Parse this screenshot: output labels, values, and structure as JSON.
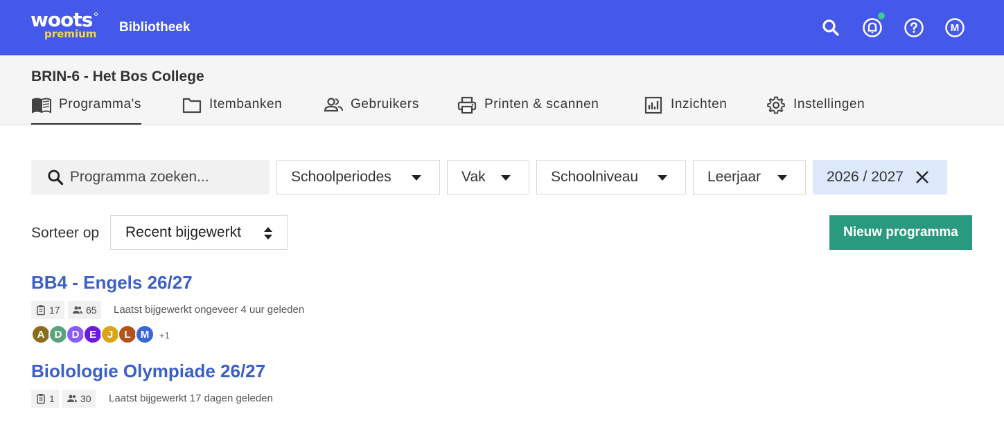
{
  "header": {
    "logo_main": "woots",
    "logo_sub": "premium",
    "app_title": "Bibliotheek",
    "avatar_initial": "M",
    "colors": {
      "bar": "#4458ea",
      "logo_sub": "#f6d54c",
      "notification_dot": "#3ec99a"
    },
    "icons": [
      "search-icon",
      "notification-bell-icon",
      "help-icon",
      "user-avatar-icon"
    ]
  },
  "school": {
    "name": "BRIN-6 - Het Bos College"
  },
  "tabs": [
    {
      "label": "Programma's",
      "icon": "open-book-icon"
    },
    {
      "label": "Itembanken",
      "icon": "folder-icon"
    },
    {
      "label": "Gebruikers",
      "icon": "users-icon"
    },
    {
      "label": "Printen & scannen",
      "icon": "printer-icon"
    },
    {
      "label": "Inzichten",
      "icon": "bar-chart-icon"
    },
    {
      "label": "Instellingen",
      "icon": "gear-icon"
    }
  ],
  "filters": {
    "search_placeholder": "Programma zoeken...",
    "dropdowns": [
      "Schoolperiodes",
      "Vak",
      "Schoolniveau",
      "Leerjaar"
    ],
    "active_year": "2026 / 2027"
  },
  "sort": {
    "label": "Sorteer op",
    "value": "Recent bijgewerkt"
  },
  "actions": {
    "new_program": "Nieuw programma",
    "new_program_color": "#2a9a7e"
  },
  "programs": [
    {
      "title": "BB4 - Engels 26/27",
      "items": "17",
      "users": "65",
      "updated": "Laatst bijgewerkt ongeveer 4 uur geleden",
      "avatars": [
        {
          "initial": "A",
          "color": "#8b6d1c"
        },
        {
          "initial": "D",
          "color": "#5aa37f"
        },
        {
          "initial": "D",
          "color": "#8b5cf6"
        },
        {
          "initial": "E",
          "color": "#6d18e0"
        },
        {
          "initial": "J",
          "color": "#d9a619"
        },
        {
          "initial": "L",
          "color": "#b4531b"
        },
        {
          "initial": "M",
          "color": "#3a66d6"
        }
      ],
      "more": "+1"
    },
    {
      "title": "Biolologie Olympiade 26/27",
      "items": "1",
      "users": "30",
      "updated": "Laatst bijgewerkt 17 dagen geleden"
    }
  ]
}
